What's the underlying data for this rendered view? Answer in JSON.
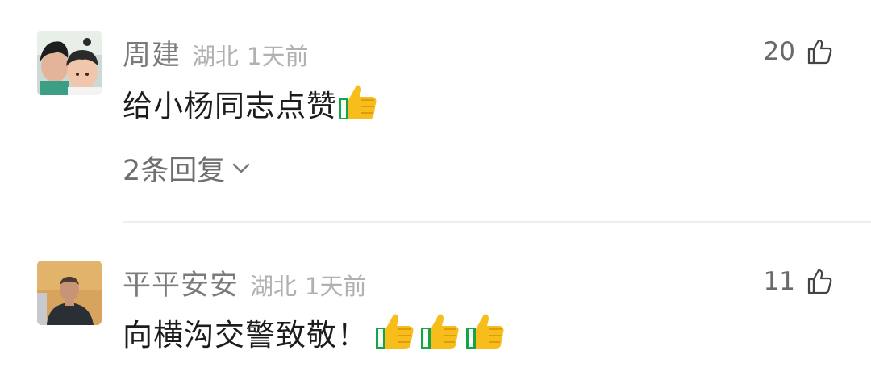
{
  "comments": [
    {
      "username": "周建",
      "location": "湖北",
      "time": "1天前",
      "likes": "20",
      "text": "给小杨同志点赞",
      "thumb_emoji_count": 1,
      "replies_label": "2条回复",
      "avatar_icon": "avatar-photo-two-children"
    },
    {
      "username": "平平安安",
      "location": "湖北",
      "time": "1天前",
      "likes": "11",
      "text": "向横沟交警致敬！",
      "thumb_emoji_count": 3,
      "avatar_icon": "avatar-photo-man"
    }
  ],
  "icons": {
    "like": "thumb-up-outline-icon",
    "emoji": "thumbs-up-emoji",
    "expand": "chevron-down-icon"
  },
  "colors": {
    "username": "#7b7b7b",
    "meta": "#b1b1b1",
    "text": "#1c1c1c",
    "emoji_yellow": "#f6bd1b",
    "emoji_green": "#18a34a"
  }
}
